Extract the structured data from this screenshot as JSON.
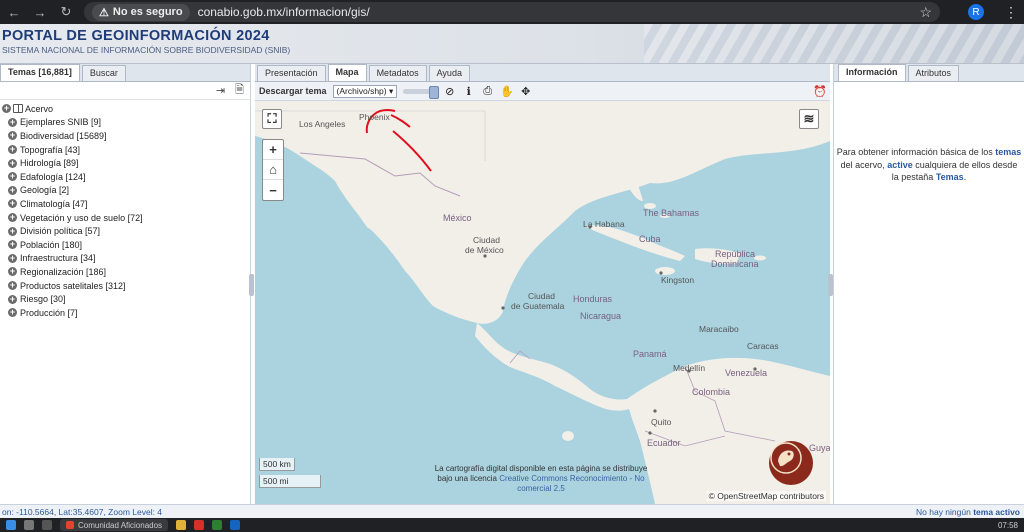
{
  "browser": {
    "security_label": "No es seguro",
    "url": "conabio.gob.mx/informacion/gis/",
    "profile_initial": "R"
  },
  "header": {
    "title": "PORTAL DE GEOINFORMACIÓN 2024",
    "subtitle": "SISTEMA NACIONAL DE INFORMACIÓN SOBRE BIODIVERSIDAD (SNIB)"
  },
  "left_panel": {
    "tabs": [
      {
        "label": "Temas [16,881]",
        "active": true
      },
      {
        "label": "Buscar",
        "active": false
      }
    ],
    "tree_root": "Acervo",
    "tree_items": [
      "Ejemplares SNIB [9]",
      "Biodiversidad [15689]",
      "Topografía [43]",
      "Hidrología [89]",
      "Edafología [124]",
      "Geología [2]",
      "Climatología [47]",
      "Vegetación y uso de suelo [72]",
      "División política [57]",
      "Población [180]",
      "Infraestructura [34]",
      "Regionalización [186]",
      "Productos satelitales [312]",
      "Riesgo [30]",
      "Producción [7]"
    ]
  },
  "center_panel": {
    "tabs": [
      {
        "label": "Presentación",
        "active": false
      },
      {
        "label": "Mapa",
        "active": true
      },
      {
        "label": "Metadatos",
        "active": false
      },
      {
        "label": "Ayuda",
        "active": false
      }
    ],
    "download_label": "Descargar tema",
    "download_select": "(Archivo/shp)"
  },
  "map": {
    "labels": {
      "los_angeles": "Los Angeles",
      "phoenix": "Phoenix",
      "mexico": "México",
      "ciudad_mexico_1": "Ciudad",
      "ciudad_mexico_2": "de México",
      "la_habana": "La Habana",
      "bahamas": "The Bahamas",
      "cuba": "Cuba",
      "republica_1": "República",
      "republica_2": "Dominicana",
      "kingston": "Kingston",
      "ciudad_guatemala_1": "Ciudad",
      "ciudad_guatemala_2": "de Guatemala",
      "honduras": "Honduras",
      "nicaragua": "Nicaragua",
      "maracaibo": "Maracaibo",
      "caracas": "Caracas",
      "panama": "Panamá",
      "medellin": "Medellín",
      "venezuela": "Venezuela",
      "colombia": "Colombia",
      "quito": "Quito",
      "ecuador": "Ecuador",
      "guyana": "Guyana"
    },
    "scale_km": "500 km",
    "scale_mi": "500 mi",
    "attribution_text": "La cartografía digital disponible en esta página se distribuye bajo una licencia",
    "attribution_link": "Creative Commons Reconocimiento - No comercial 2.5",
    "osm_attribution": "© OpenStreetMap contributors",
    "colors": {
      "water": "#aad3df",
      "land": "#f2efe9",
      "border": "#b49bb8",
      "annotation": "#e0101c"
    }
  },
  "right_panel": {
    "tabs": [
      {
        "label": "Información",
        "active": true
      },
      {
        "label": "Atributos",
        "active": false
      }
    ],
    "info_pre": "Para obtener información básica de los",
    "info_temas": "temas",
    "info_mid": "del acervo,",
    "info_active": "active",
    "info_post": "cualquiera de ellos desde la pestaña",
    "info_tab": "Temas",
    "info_end": "."
  },
  "status_bar": {
    "coords": "on: -110.5664, Lat:35.4607, Zoom Level: 4",
    "no_theme_pre": "No hay ningún",
    "no_theme_bold": "tema activo"
  },
  "taskbar": {
    "app_label": "Comunidad Aficionados",
    "clock": "07:58"
  }
}
